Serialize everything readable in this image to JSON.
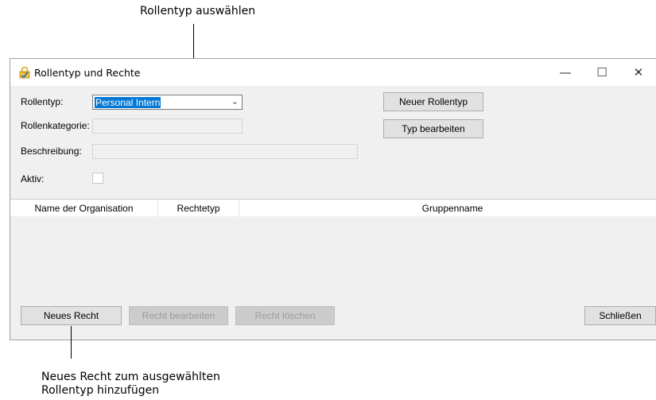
{
  "annotations": {
    "top": "Rollentyp auswählen",
    "bottom_line1": "Neues Recht zum ausgewählten",
    "bottom_line2": "Rollentyp hinzufügen"
  },
  "window": {
    "title": "Rollentyp und Rechte",
    "minimize": "—",
    "maximize": "☐",
    "close": "✕"
  },
  "form": {
    "rollentyp_label": "Rollentyp:",
    "rollentyp_value": "Personal Intern",
    "rollenkategorie_label": "Rollenkategorie:",
    "beschreibung_label": "Beschreibung:",
    "aktiv_label": "Aktiv:"
  },
  "buttons": {
    "neuer_rollentyp": "Neuer Rollentyp",
    "typ_bearbeiten": "Typ bearbeiten",
    "neues_recht": "Neues Recht",
    "recht_bearbeiten": "Recht bearbeiten",
    "recht_loeschen": "Recht löschen",
    "schliessen": "Schließen"
  },
  "grid": {
    "columns": [
      "Name der Organisation",
      "Rechtetyp",
      "Gruppenname"
    ]
  }
}
